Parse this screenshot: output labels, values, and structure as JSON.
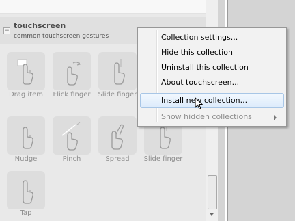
{
  "collection": {
    "title": "touchscreen",
    "subtitle": "common touchscreen gestures",
    "toggle_symbol": "−"
  },
  "gestures": [
    {
      "label": "Drag item",
      "icon": "drag-item-gesture-icon"
    },
    {
      "label": "Flick finger",
      "icon": "flick-finger-gesture-icon"
    },
    {
      "label": "Slide finger",
      "icon": "slide-finger-gesture-icon"
    },
    {
      "label": "Nudge",
      "icon": "nudge-gesture-icon"
    },
    {
      "label": "Pinch",
      "icon": "pinch-gesture-icon"
    },
    {
      "label": "Spread",
      "icon": "spread-gesture-icon"
    },
    {
      "label": "Slide finger",
      "icon": "slide-finger-gesture-icon"
    },
    {
      "label": "Tap",
      "icon": "tap-gesture-icon"
    }
  ],
  "context_menu": {
    "items": [
      {
        "label": "Collection settings...",
        "enabled": true
      },
      {
        "label": "Hide this collection",
        "enabled": true
      },
      {
        "label": "Uninstall this collection",
        "enabled": true
      },
      {
        "label": "About touchscreen...",
        "enabled": true
      },
      {
        "label": "Install new collection...",
        "enabled": true,
        "highlighted": true
      },
      {
        "label": "Show hidden collections",
        "enabled": false,
        "submenu": true
      }
    ]
  },
  "colors": {
    "menu_highlight_border": "#a8c6e6",
    "menu_background": "#f2f2f2",
    "panel_background": "#e9e9e9",
    "disabled_text": "#8c8c8c"
  }
}
